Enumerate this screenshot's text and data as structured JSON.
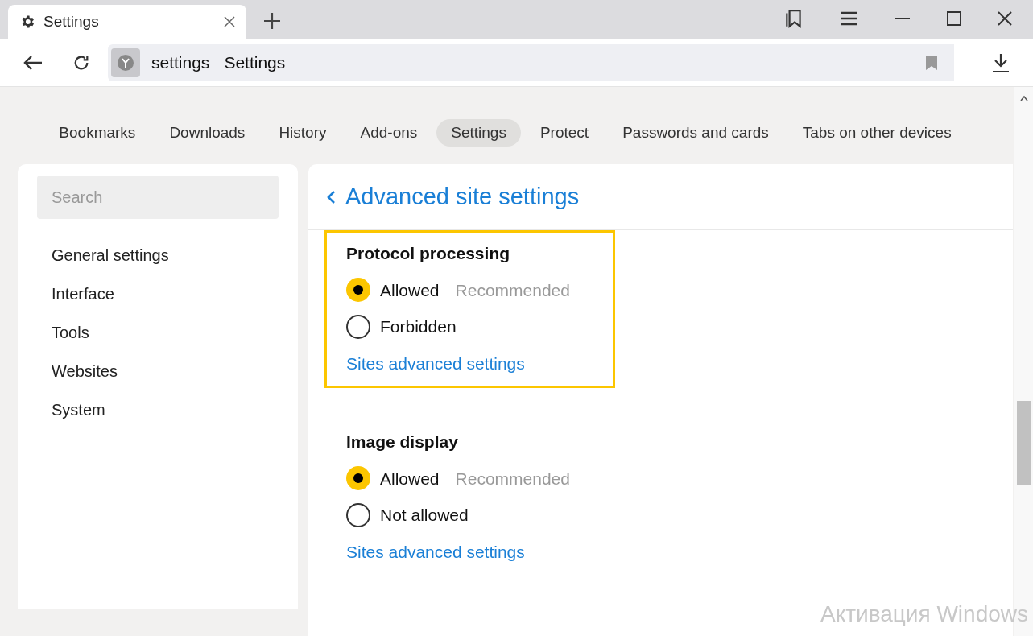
{
  "browser_tab": {
    "title": "Settings",
    "selected": true
  },
  "address_bar": {
    "host": "settings",
    "page_title": "Settings"
  },
  "nav_tabs": [
    {
      "label": "Bookmarks",
      "selected": false
    },
    {
      "label": "Downloads",
      "selected": false
    },
    {
      "label": "History",
      "selected": false
    },
    {
      "label": "Add-ons",
      "selected": false
    },
    {
      "label": "Settings",
      "selected": true
    },
    {
      "label": "Protect",
      "selected": false
    },
    {
      "label": "Passwords and cards",
      "selected": false
    },
    {
      "label": "Tabs on other devices",
      "selected": false
    }
  ],
  "sidebar": {
    "search": {
      "placeholder": "Search"
    },
    "items": [
      "General settings",
      "Interface",
      "Tools",
      "Websites",
      "System"
    ]
  },
  "page_title": "Advanced site settings",
  "sections": [
    {
      "title": "Protocol processing",
      "highlighted": true,
      "options": [
        {
          "label": "Allowed",
          "note": "Recommended",
          "selected": true
        },
        {
          "label": "Forbidden",
          "selected": false
        }
      ],
      "link": "Sites advanced settings"
    },
    {
      "title": "Image display",
      "options": [
        {
          "label": "Allowed",
          "note": "Recommended",
          "selected": true
        },
        {
          "label": "Not allowed",
          "selected": false
        }
      ],
      "link": "Sites advanced settings"
    }
  ],
  "os_notice": "Активация Windows"
}
